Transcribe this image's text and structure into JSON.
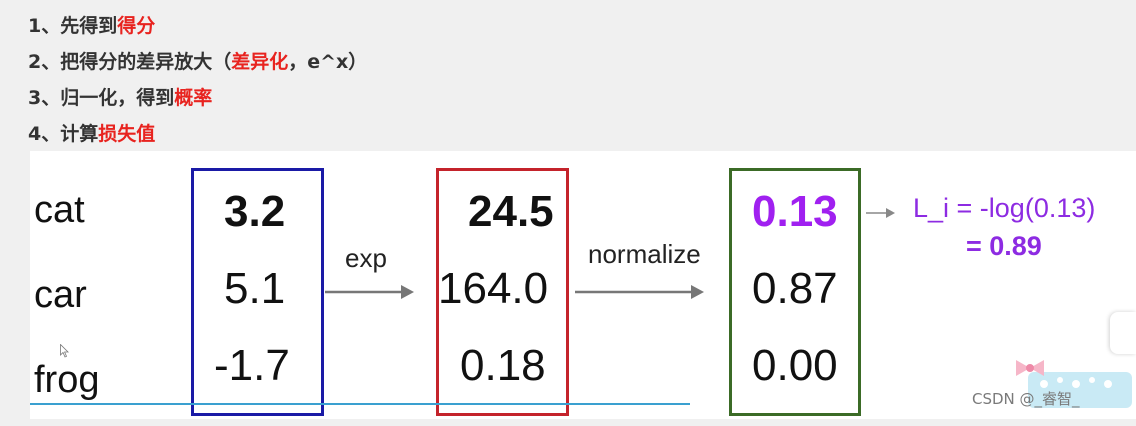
{
  "notes": [
    {
      "plain": "1、先得到",
      "highlight": "得分",
      "tail": ""
    },
    {
      "plain": "2、把得分的差异放大（",
      "highlight": "差异化",
      "tail": "，e^x）"
    },
    {
      "plain": "3、归一化，得到",
      "highlight": "概率",
      "tail": ""
    },
    {
      "plain": "4、计算",
      "highlight": "损失值",
      "tail": ""
    }
  ],
  "slide": {
    "classes": [
      "cat",
      "car",
      "frog"
    ],
    "scores": [
      "3.2",
      "5.1",
      "-1.7"
    ],
    "exp_label": "exp",
    "exp_values": [
      "24.5",
      "164.0",
      "0.18"
    ],
    "normalize_label": "normalize",
    "probabilities": [
      "0.13",
      "0.87",
      "0.00"
    ],
    "loss_formula": "L_i = -log(0.13)",
    "loss_result": "= 0.89"
  },
  "colors": {
    "highlight": "#e8231f",
    "scores_box": "#1a1aa6",
    "exp_box": "#c4232b",
    "prob_box": "#3b6b26",
    "formula": "#8d2be2"
  },
  "watermark": "CSDN @_睿智_"
}
